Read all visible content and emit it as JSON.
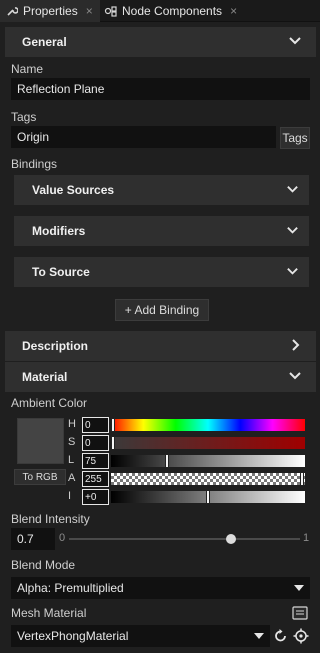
{
  "tabs": [
    {
      "label": "Properties",
      "icon": "wrench-icon",
      "close": "×"
    },
    {
      "label": "Node Components",
      "icon": "components-icon",
      "close": "×"
    }
  ],
  "general": {
    "header": "General",
    "name_label": "Name",
    "name_value": "Reflection Plane",
    "tags_label": "Tags",
    "tags_value": "Origin",
    "tags_button": "Tags",
    "bindings_label": "Bindings",
    "subsections": [
      "Value Sources",
      "Modifiers",
      "To Source"
    ],
    "add_binding": "+ Add Binding"
  },
  "description": {
    "header": "Description"
  },
  "material": {
    "header": "Material",
    "ambient_label": "Ambient Color",
    "to_rgb": "To RGB",
    "channels": [
      {
        "label": "H",
        "value": "0",
        "position": 0.0
      },
      {
        "label": "S",
        "value": "0",
        "position": 0.0
      },
      {
        "label": "L",
        "value": "75",
        "position": 0.29
      },
      {
        "label": "A",
        "value": "255",
        "position": 1.0
      },
      {
        "label": "I",
        "value": "+0",
        "position": 0.5
      }
    ],
    "blend_intensity_label": "Blend Intensity",
    "blend_intensity_value": "0.7",
    "slider_min": "0",
    "slider_max": "1",
    "slider_value": 0.7,
    "blend_mode_label": "Blend Mode",
    "blend_mode_value": "Alpha: Premultiplied",
    "mesh_material_label": "Mesh Material",
    "mesh_material_value": "VertexPhongMaterial"
  },
  "colors": {
    "panel_bg": "#1f1f1f",
    "section_bg": "#2f2f2f",
    "field_bg": "#111111",
    "accent_red": "#a00000"
  }
}
